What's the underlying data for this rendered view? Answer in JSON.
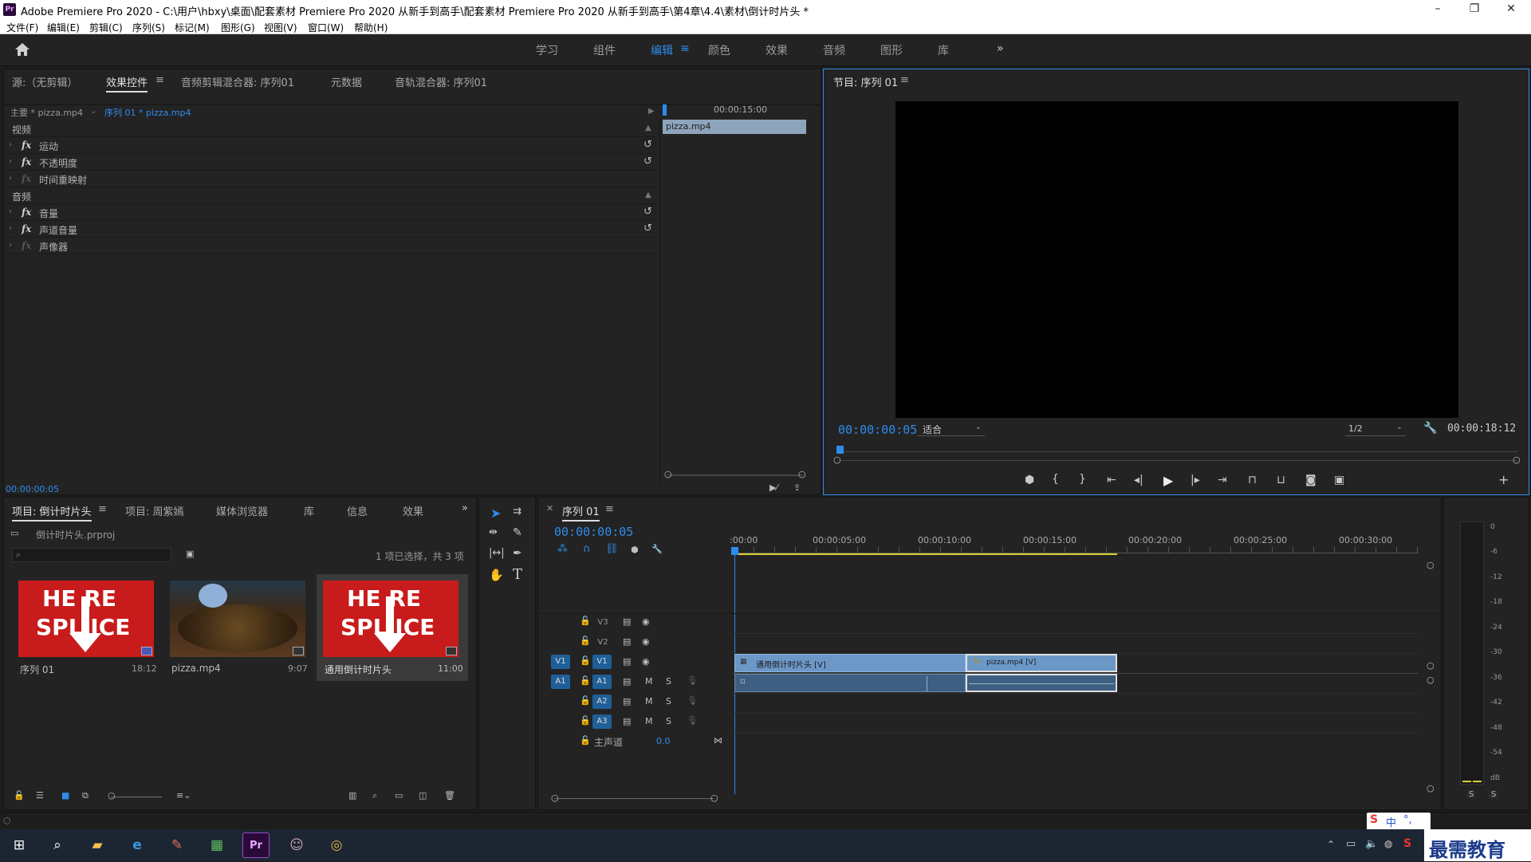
{
  "titlebar": {
    "app_icon": "Pr",
    "title": "Adobe Premiere Pro 2020 - C:\\用户\\hbxy\\桌面\\配套素材 Premiere Pro 2020 从新手到高手\\配套素材 Premiere Pro 2020 从新手到高手\\第4章\\4.4\\素材\\倒计时片头 *",
    "minimize": "–",
    "maximize": "❐",
    "close": "✕"
  },
  "menubar": [
    "文件(F)",
    "编辑(E)",
    "剪辑(C)",
    "序列(S)",
    "标记(M)",
    "图形(G)",
    "视图(V)",
    "窗口(W)",
    "帮助(H)"
  ],
  "workspaces": {
    "items": [
      "学习",
      "组件",
      "编辑",
      "颜色",
      "效果",
      "音频",
      "图形",
      "库"
    ],
    "active": "编辑",
    "overflow": "»"
  },
  "effect_panel": {
    "tabs": [
      "源:（无剪辑）",
      "效果控件",
      "音频剪辑混合器: 序列01",
      "元数据",
      "音轨混合器: 序列01"
    ],
    "active_tab": "效果控件",
    "master_label": "主要 * pizza.mp4",
    "sequence_label": "序列 01 * pizza.mp4",
    "ruler_time": "00:00:15:00",
    "clip_label": "pizza.mp4",
    "video_section": "视频",
    "video_effects": [
      "运动",
      "不透明度",
      "时间重映射"
    ],
    "audio_section": "音频",
    "audio_effects": [
      "音量",
      "声道音量",
      "声像器"
    ],
    "fx_symbol": "fx",
    "timecode": "00:00:00:05"
  },
  "program_monitor": {
    "title": "节目: 序列 01",
    "timecode": "00:00:00:05",
    "fit": "适合",
    "resolution": "1/2",
    "duration": "00:00:18:12"
  },
  "project_panel": {
    "tabs": [
      "项目: 倒计时片头",
      "项目: 周紫嫣",
      "媒体浏览器",
      "库",
      "信息",
      "效果"
    ],
    "active_tab": "项目: 倒计时片头",
    "project_file": "倒计时片头.prproj",
    "search_placeholder": "",
    "selection_info": "1 项已选择，共 3 项",
    "items": [
      {
        "name": "序列 01",
        "duration": "18:12"
      },
      {
        "name": "pizza.mp4",
        "duration": "9:07"
      },
      {
        "name": "通用倒计时片头",
        "duration": "11:00"
      }
    ],
    "thumb_text_top": "HE RE",
    "thumb_text_bottom": "SPL ICE"
  },
  "timeline": {
    "title": "序列 01",
    "timecode": "00:00:00:05",
    "ruler": [
      ":00:00",
      "00:00:05:00",
      "00:00:10:00",
      "00:00:15:00",
      "00:00:20:00",
      "00:00:25:00",
      "00:00:30:00"
    ],
    "video_tracks": [
      "V3",
      "V2",
      "V1"
    ],
    "audio_tracks": [
      "A1",
      "A2",
      "A3"
    ],
    "source_v": "V1",
    "source_a": "A1",
    "mute": "M",
    "solo": "S",
    "master_label": "主声道",
    "master_value": "0.0",
    "clip_video_1": "通用倒计时片头 [V]",
    "clip_video_2": "pizza.mp4 [V]"
  },
  "meter": {
    "scale": [
      "0",
      "-6",
      "-12",
      "-18",
      "-24",
      "-30",
      "-36",
      "-42",
      "-48",
      "-54",
      "dB"
    ],
    "solo_left": "S",
    "solo_right": "S"
  },
  "taskbar": {
    "ime": "中",
    "watermark": "最需教育"
  }
}
